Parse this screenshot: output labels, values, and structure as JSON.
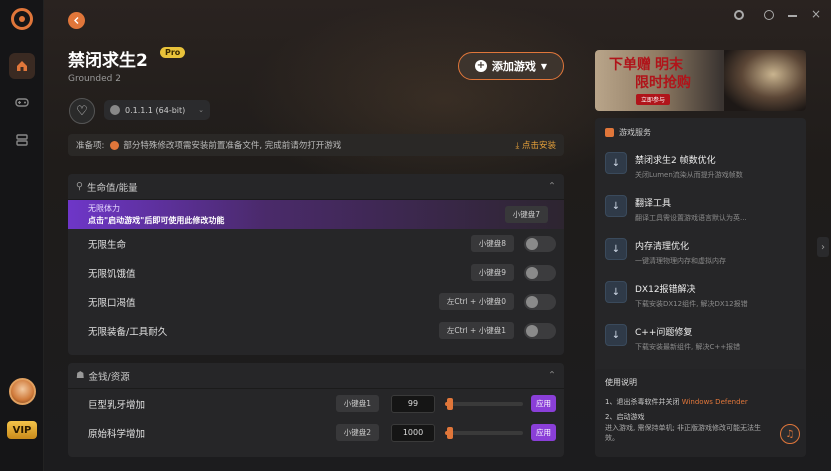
{
  "app": {
    "logo_icon": "app-logo-icon",
    "vip_label": "VIP"
  },
  "sidebar": {
    "items": [
      {
        "icon": "home-icon"
      },
      {
        "icon": "gamepad-icon"
      },
      {
        "icon": "layers-icon"
      }
    ]
  },
  "game": {
    "title": "禁闭求生2",
    "badge": "Pro",
    "subtitle": "Grounded 2",
    "version": "0.1.1.1 (64-bit)"
  },
  "add_game_label": "添加游戏",
  "prep": {
    "label": "准备项:",
    "text": "部分特殊修改项需安装前置准备文件, 完成前请勿打开游戏",
    "install_label": "点击安装"
  },
  "sections": [
    {
      "title": "生命值/能量",
      "promo": {
        "title": "无限体力",
        "text": "点击\"启动游戏\"后即可使用此修改功能",
        "key": "小键盘7"
      },
      "rows": [
        {
          "label": "无限生命",
          "key": "小键盘8"
        },
        {
          "label": "无限饥饿值",
          "key": "小键盘9"
        },
        {
          "label": "无限口渴值",
          "key": "左Ctrl + 小键盘0"
        },
        {
          "label": "无限装备/工具耐久",
          "key": "左Ctrl + 小键盘1"
        }
      ]
    },
    {
      "title": "金钱/资源",
      "rows": [
        {
          "label": "巨型乳牙增加",
          "key": "小键盘1",
          "value": "99",
          "apply": "应用"
        },
        {
          "label": "原始科学增加",
          "key": "小键盘2",
          "value": "1000",
          "apply": "应用"
        }
      ]
    }
  ],
  "banner": {
    "line1": "下单赠",
    "line1b": "明末",
    "line2": "限时抢购",
    "cta": "立即参与"
  },
  "services": {
    "title": "游戏服务",
    "items": [
      {
        "title": "禁闭求生2 帧数优化",
        "desc": "关闭Lumen流染从而提升游戏帧数"
      },
      {
        "title": "翻译工具",
        "desc": "翻译工具需设置游戏语言默认为英..."
      },
      {
        "title": "内存清理优化",
        "desc": "一键清理物理内存和虚拟内存"
      },
      {
        "title": "DX12报错解决",
        "desc": "下载安装DX12组件, 解决DX12报错"
      },
      {
        "title": "C++问题修复",
        "desc": "下载安装最新组件, 解决C++报错"
      }
    ]
  },
  "usage": {
    "title": "使用说明",
    "step1": "1、退出杀毒软件并关闭",
    "step1_highlight": "Windows Defender",
    "step2": "2、启动游戏",
    "step2_desc": "进入游戏, 需保持单机; 非正版游戏修改可能无法生效。"
  }
}
